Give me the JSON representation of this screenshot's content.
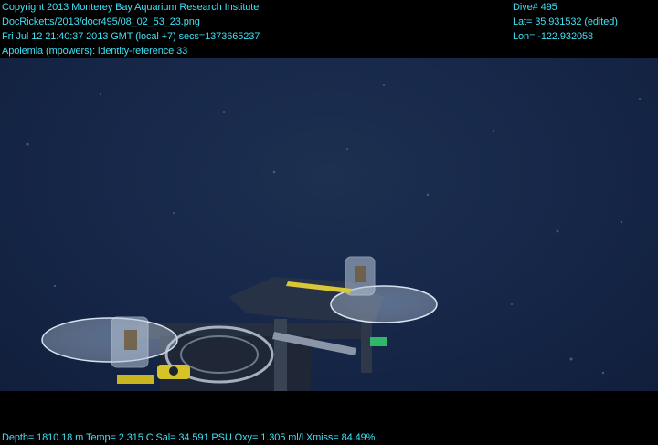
{
  "overlay": {
    "top_left": [
      "Copyright 2013 Monterey Bay Aquarium Research Institute",
      "DocRicketts/2013/docr495/08_02_53_23.png",
      "Fri Jul 12 21:40:37 2013 GMT (local +7)  secs=1373665237",
      "Apolemia (mpowers): identity-reference 33"
    ],
    "top_right": [
      "Dive# 495",
      "Lat= 35.931532 (edited)",
      "Lon= -122.932058"
    ],
    "bottom": "Depth= 1810.18 m  Temp= 2.315 C  Sal= 34.591 PSU  Oxy= 1.305 ml/l  Xmiss= 84.49%"
  },
  "colors": {
    "overlay_text": "#3fe0f5",
    "water": "#17284a",
    "letterbox": "#000000"
  },
  "scene": {
    "subject": "ROV sampling apparatus with clear acrylic disks against deep-sea water"
  }
}
